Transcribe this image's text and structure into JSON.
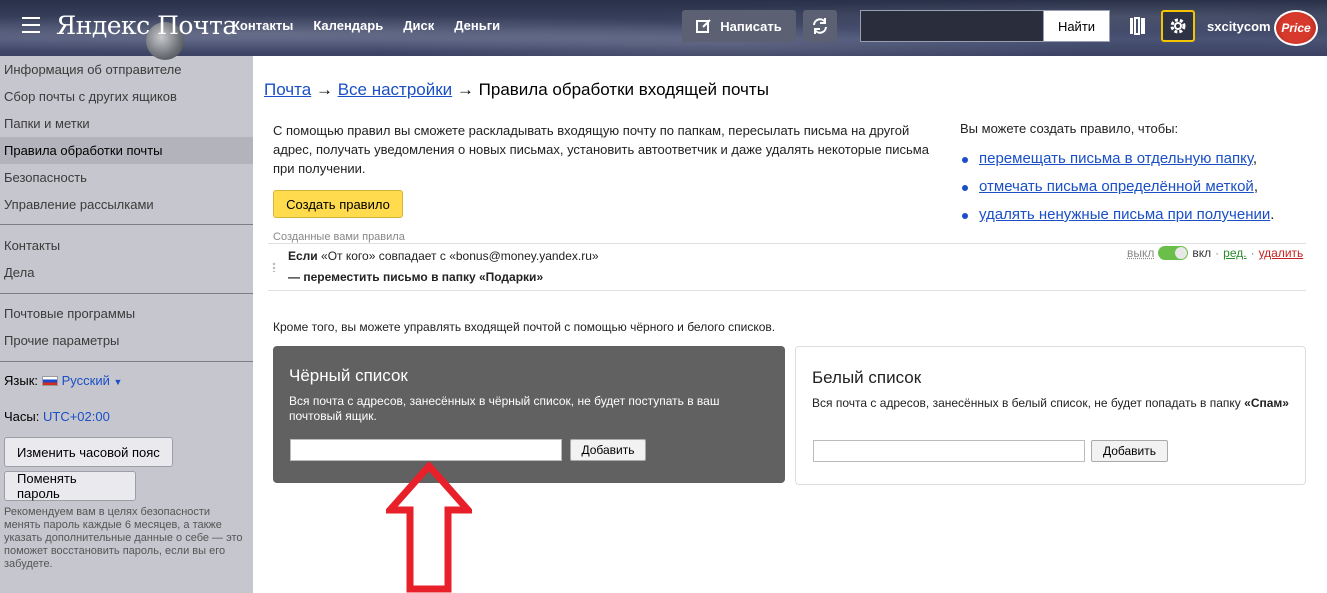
{
  "header": {
    "logo": "Яндекс Почта",
    "nav": [
      "Контакты",
      "Календарь",
      "Диск",
      "Деньги"
    ],
    "compose_label": "Написать",
    "search_placeholder": "",
    "search_button": "Найти",
    "username": "sxcitycom",
    "avatar_text": "Price",
    "accent_color": "#f5c400"
  },
  "sidebar": {
    "items": [
      "Информация об отправителе",
      "Сбор почты с других ящиков",
      "Папки и метки",
      "Правила обработки почты",
      "Безопасность",
      "Управление рассылками"
    ],
    "items2": [
      "Контакты",
      "Дела"
    ],
    "items3": [
      "Почтовые программы",
      "Прочие параметры"
    ],
    "lang_label": "Язык:",
    "lang_value": "Русский",
    "lang_caret": "▼",
    "clock_label": "Часы:",
    "clock_value": "UTC+02:00",
    "timezone_button": "Изменить часовой пояс",
    "password_button": "Поменять пароль",
    "note": "Рекомендуем вам в целях безопасности менять пароль каждые 6 месяцев, а также указать дополнительные данные о себе — это поможет восстановить пароль, если вы его забудете."
  },
  "main": {
    "breadcrumb": {
      "mail": "Почта",
      "arrow": "→",
      "all_settings": "Все настройки",
      "current": "Правила обработки входящей почты"
    },
    "intro": "С помощью правил вы сможете раскладывать входящую почту по папкам, пересылать письма на другой адрес, получать уведомления о новых письмах, установить автоответчик и даже удалять некоторые письма при получении.",
    "create_button": "Создать правило",
    "can_title": "Вы можете создать правило, чтобы:",
    "can_items": [
      {
        "link": "перемещать письма в отдельную папку",
        "tail": ","
      },
      {
        "link": "отмечать письма определённой меткой",
        "tail": ","
      },
      {
        "link": "удалять ненужные письма при получении",
        "tail": "."
      }
    ],
    "rules_label": "Созданные вами правила",
    "rule": {
      "if_word": "Если",
      "condition": "«От кого» совпадает с «bonus@money.yandex.ru»",
      "action": "— переместить письмо в папку «Подарки»",
      "off": "выкл",
      "on": "вкл",
      "sep": "·",
      "edit": "ред.",
      "delete": "удалить",
      "enabled": true
    },
    "lists_intro": "Кроме того, вы можете управлять входящей почтой с помощью чёрного и белого списков.",
    "blacklist": {
      "title": "Чёрный список",
      "desc": "Вся почта с адресов, занесённых в чёрный список, не будет поступать в ваш почтовый ящик.",
      "add": "Добавить",
      "value": ""
    },
    "whitelist": {
      "title": "Белый список",
      "desc": "Вся почта с адресов, занесённых в белый список, не будет попадать в папку",
      "desc_bold": "«Спам»",
      "add": "Добавить",
      "value": ""
    }
  }
}
